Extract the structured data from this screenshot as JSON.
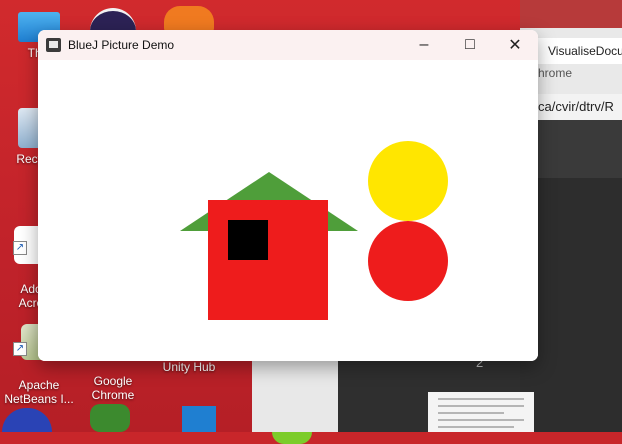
{
  "desktop": {
    "icons": [
      {
        "label": "This"
      },
      {
        "label": "Recyc"
      },
      {
        "label": "Ado\nAcro"
      },
      {
        "label": "Apache\nNetBeans I..."
      },
      {
        "label": "Google\nChrome"
      },
      {
        "label": "Unity Hub"
      }
    ]
  },
  "background_browser": {
    "tab_title": "VisualiseDocu",
    "sub_text": "hrome",
    "address": "ca/cvir/dtrv/R",
    "page_number": "2"
  },
  "window": {
    "title": "BlueJ Picture Demo",
    "controls": {
      "minimize": "–",
      "maximize": "□",
      "close": "✕"
    }
  },
  "picture": {
    "colors": {
      "wall": "#ee1c1c",
      "window": "#000000",
      "roof": "#4f9e3a",
      "sun": "#ffe600",
      "ball": "#ee1c1c"
    }
  }
}
